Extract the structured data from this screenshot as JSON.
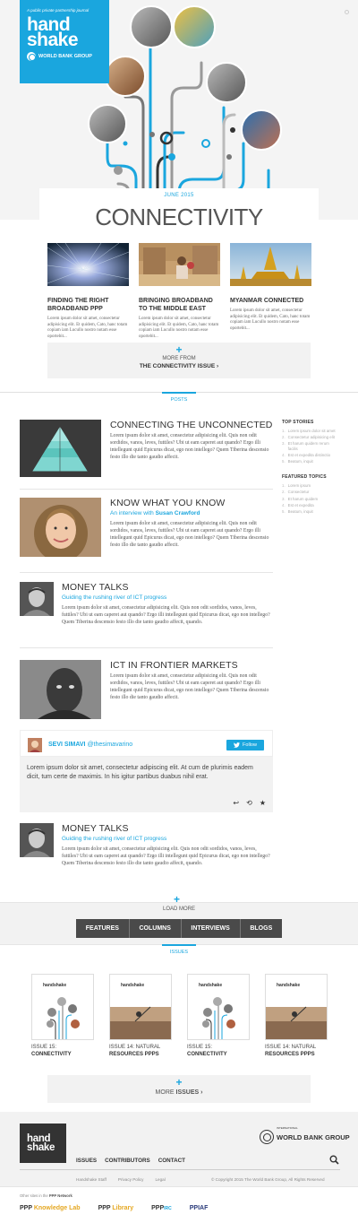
{
  "logo": {
    "tagline": "A public private partnership journal",
    "brand_line1": "hand",
    "brand_line2": "shake",
    "org": "WORLD BANK GROUP"
  },
  "issue": {
    "date": "JUNE 2015",
    "title": "CONNECTIVITY"
  },
  "features": [
    {
      "title": "FINDING THE RIGHT BROADBAND PPP",
      "excerpt": "Lorem ipsum dolor sit amet, consectetur adipisicing elit. Et quidem, Cato, hanc totam copiam iam Lucullo nostro notam esse oportebit..."
    },
    {
      "title": "BRINGING BROADBAND TO THE MIDDLE EAST",
      "excerpt": "Lorem ipsum dolor sit amet, consectetur adipisicing elit. Et quidem, Cato, hanc totam copiam iam Lucullo nostro notam esse oportebit..."
    },
    {
      "title": "MYANMAR CONNECTED",
      "excerpt": "Lorem ipsum dolor sit amet, consectetur adipisicing elit. Et quidem, Cato, hanc totam copiam iam Lucullo nostro notam esse oportebit..."
    }
  ],
  "more_issue": {
    "small": "MORE FROM",
    "big": "THE CONNECTIVITY ISSUE ›"
  },
  "posts_tab": "POSTS",
  "posts": [
    {
      "title": "CONNECTING THE UNCONNECTED",
      "subtitle": "",
      "subtitle_name": "",
      "body": "Lorem ipsum dolor sit amet, consectetur adipisicing elit. Quis non odit sordidos, vanos, leves, futtiles? Ubi ut eam caperet aut quando? Ergo illi intellegunt quid Epicurus dicat, ego non intellego? Quem Tiberina descensio festo illo die tanto gaudio affecit."
    },
    {
      "title": "KNOW WHAT YOU KNOW",
      "subtitle": "An interview with ",
      "subtitle_name": "Susan Crawford",
      "body": "Lorem ipsum dolor sit amet, consectetur adipisicing elit. Quis non odit sordidos, vanos, leves, futtiles? Ubi ut eam caperet aut quando? Ergo illi intellegunt quid Epicurus dicat, ego non intellego? Quem Tiberina descensio festo illo die tanto gaudio affecit."
    },
    {
      "title": "MONEY TALKS",
      "subtitle": "Guiding the rushing river of ICT progress",
      "subtitle_name": "",
      "body": "Lorem ipsum dolor sit amet, consectetur adipisicing elit. Quis non odit sordidos, vanos, leves, futtiles? Ubi ut eam caperet aut quando? Ergo illi intellegunt quid Epicurus dicat, ego non intellego? Quem Tiberina descensio festo illo die tanto gaudio affecit, quando."
    },
    {
      "title": "ICT IN FRONTIER MARKETS",
      "subtitle": "",
      "subtitle_name": "",
      "body": "Lorem ipsum dolor sit amet, consectetur adipisicing elit. Quis non odit sordidos, vanos, leves, futtiles? Ubi ut eam caperet aut quando? Ergo illi intellegunt quid Epicurus dicat, ego non intellego? Quem Tiberina descensio festo illo die tanto gaudio affecit."
    },
    {
      "title": "MONEY TALKS",
      "subtitle": "Guiding the rushing river of ICT progress",
      "subtitle_name": "",
      "body": "Lorem ipsum dolor sit amet, consectetur adipisicing elit. Quis non odit sordidos, vanos, leves, futtiles? Ubi ut eam caperet aut quando? Ergo illi intellegunt quid Epicurus dicat, ego non intellego? Quem Tiberina descensio festo illo die tanto gaudio affecit, quando."
    }
  ],
  "tweet": {
    "author": "SEVI SIMAVI",
    "handle": "@thesimavarino",
    "follow": "Follow",
    "text": "Lorem ipsum dolor sit amet, consectetur adipiscing elit. At cum de plurimis eadem dicit, tum certe de maximis. In his igitur partibus duabus nihil erat."
  },
  "sidebar": {
    "top_title": "TOP STORIES",
    "top": [
      {
        "n": "1.",
        "t": "Lorem ipsum dolor sit amet"
      },
      {
        "n": "2.",
        "t": "Consectetur adipisicing elit"
      },
      {
        "n": "3.",
        "t": "Et harum quidem rerum facilis"
      },
      {
        "n": "4.",
        "t": "Est et expedita distinctio"
      },
      {
        "n": "5.",
        "t": "Beatum, inquit"
      }
    ],
    "topics_title": "FEATURED TOPICS",
    "topics": [
      {
        "n": "1.",
        "t": "Lorem ipsum"
      },
      {
        "n": "2.",
        "t": "Consectetur"
      },
      {
        "n": "3.",
        "t": "Et harum quidem"
      },
      {
        "n": "4.",
        "t": "Est et expedita"
      },
      {
        "n": "5.",
        "t": "Beatum, inquit"
      }
    ]
  },
  "load_more": "LOAD MORE",
  "filters": [
    "FEATURES",
    "COLUMNS",
    "INTERVIEWS",
    "BLOGS"
  ],
  "issues_tab": "ISSUES",
  "issues": [
    {
      "cover_brand": "handshake",
      "num": "ISSUE 15:",
      "name": "CONNECTIVITY"
    },
    {
      "cover_brand": "handshake",
      "num": "ISSUE 14: NATURAL",
      "name": "RESOURCES PPPS"
    },
    {
      "cover_brand": "handshake",
      "num": "ISSUE 15:",
      "name": "CONNECTIVITY"
    },
    {
      "cover_brand": "handshake",
      "num": "ISSUE 14: NATURAL",
      "name": "RESOURCES PPPS"
    }
  ],
  "more_issues": {
    "label": "MORE ",
    "bold": "ISSUES ›"
  },
  "footer": {
    "logo_line1": "hand",
    "logo_line2": "shake",
    "wbg_pre": "INTERNATIONAL",
    "wbg": "WORLD BANK GROUP",
    "nav": [
      "ISSUES",
      "CONTRIBUTORS",
      "CONTACT"
    ],
    "sub": [
      "Handshake Staff",
      "Privacy Policy",
      "Legal"
    ],
    "copyright": "© Copyright 2015 The World Bank Group, All Rights Reserved",
    "network_pre": "Other sites in the ",
    "network_bold": "PPP Network",
    "partners": [
      {
        "a": "PPP ",
        "b": "Knowledge Lab"
      },
      {
        "a": "PPP ",
        "b": "Library"
      },
      {
        "a": "PPP",
        "b": "IRC"
      },
      {
        "a": "PPIAF",
        "b": ""
      }
    ]
  },
  "colors": {
    "accent": "#1aa6de",
    "dark": "#333333",
    "panel": "#f2f2f2"
  }
}
